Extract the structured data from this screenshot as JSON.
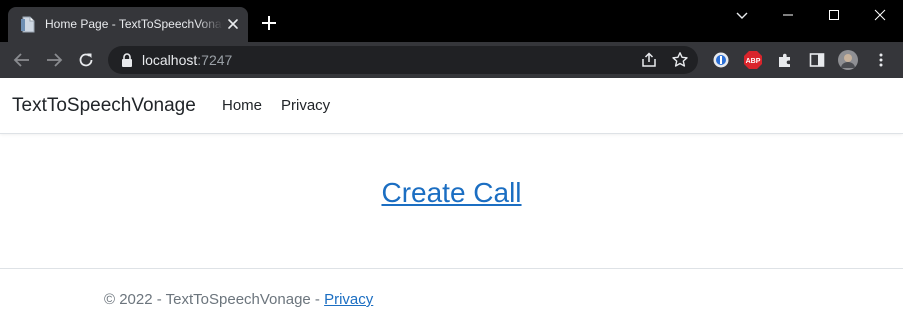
{
  "browser": {
    "tab": {
      "title": "Home Page - TextToSpeechVonage",
      "favicon": "page-icon"
    },
    "url": {
      "host": "localhost",
      "port": ":7247"
    },
    "colors": {
      "frame": "#000000",
      "toolbar": "#35363a",
      "omnibox": "#202124",
      "tab_active": "#35363a"
    },
    "extensions": [
      "one-password-icon",
      "adblock-plus-icon",
      "puzzle-extensions-icon",
      "side-panel-icon",
      "profile-avatar"
    ]
  },
  "site": {
    "brand": "TextToSpeechVonage",
    "nav": [
      "Home",
      "Privacy"
    ],
    "main_link": "Create Call",
    "footer": {
      "copyright": "© 2022 - TextToSpeechVonage - ",
      "privacy_link": "Privacy"
    },
    "colors": {
      "link": "#1b6ec2",
      "text": "#212529",
      "muted": "#6c757d",
      "border": "#dee2e6"
    }
  }
}
